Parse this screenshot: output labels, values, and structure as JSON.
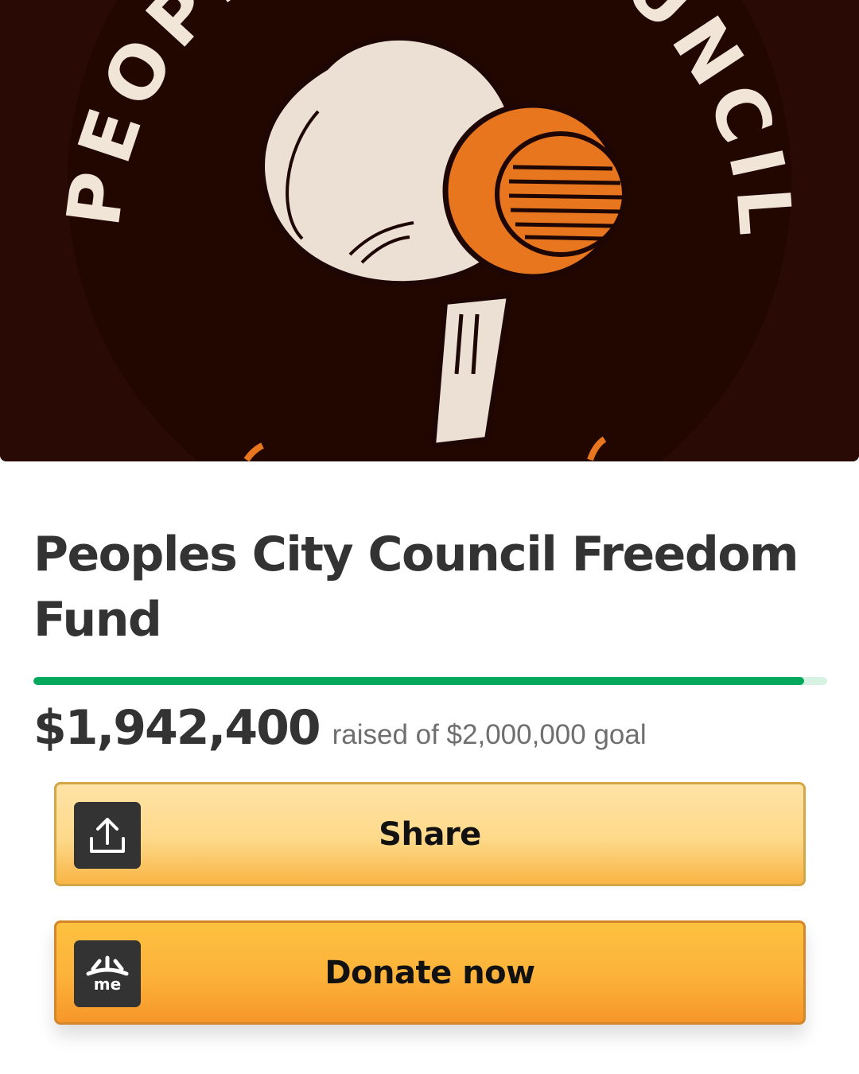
{
  "hero": {
    "image": "peoples-city-council-logo",
    "arc_text_left": "PEOPLE",
    "arc_text_right": "UNCIL"
  },
  "campaign": {
    "title": "Peoples City Council Freedom Fund",
    "amount_raised": "$1,942,400",
    "goal_text": "raised of $2,000,000 goal",
    "progress_fraction": 0.971
  },
  "actions": {
    "share_label": "Share",
    "share_icon": "share-upload-icon",
    "donate_label": "Donate now",
    "donate_icon": "gofundme-logo-icon"
  },
  "colors": {
    "progress": "#02a95c",
    "hero_bg": "#2a0a05",
    "accent_orange": "#e8761e"
  }
}
